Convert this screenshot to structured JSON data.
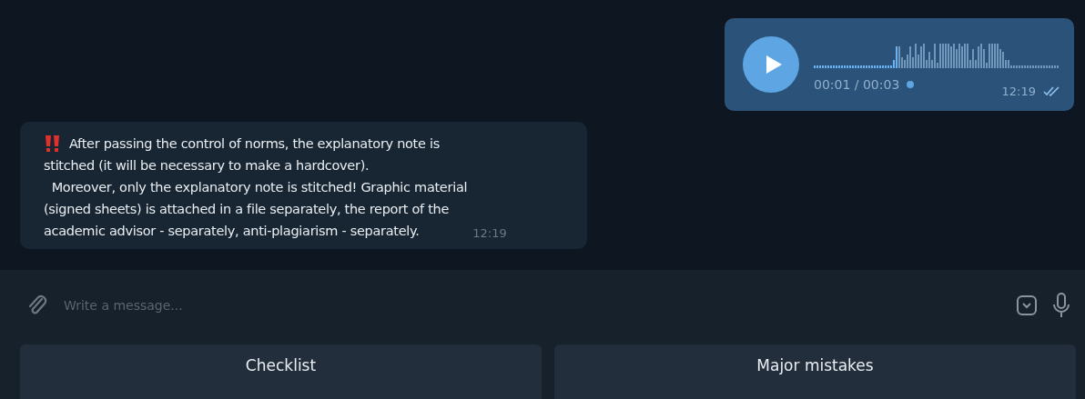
{
  "voice_message": {
    "elapsed": "00:01 / 00:03",
    "time": "12:19",
    "read": true
  },
  "text_message": {
    "paragraphs": [
      [
        "After passing the control of norms, the explanatory note is",
        "stitched (it will be necessary to make a hardcover)."
      ],
      [
        "  Moreover, only the explanatory note is stitched! Graphic material",
        "(signed sheets) is attached in a file separately, the report of the",
        "academic advisor - separately, anti-plagiarism - separately."
      ]
    ],
    "time": "12:19"
  },
  "composer": {
    "placeholder": "Write a message..."
  },
  "keyboard_buttons": [
    "Checklist",
    "Major mistakes"
  ]
}
